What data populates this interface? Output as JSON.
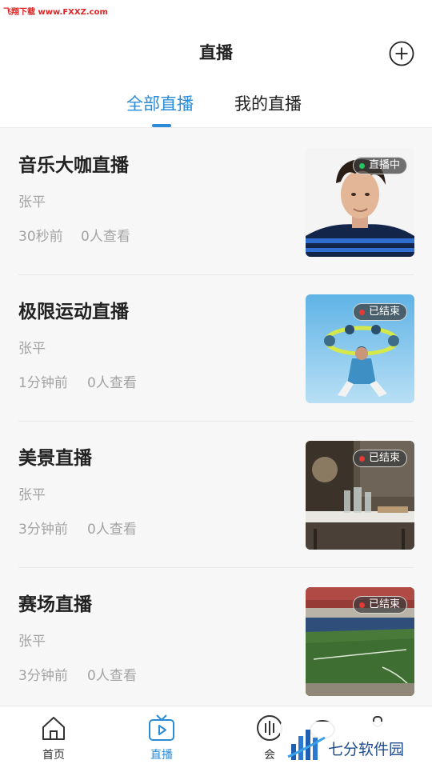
{
  "watermark_top": "飞翔下载 www.FXXZ.com",
  "header": {
    "title": "直播",
    "add_icon": "plus-circle-icon"
  },
  "tabs": [
    {
      "label": "全部直播",
      "active": true
    },
    {
      "label": "我的直播",
      "active": false
    }
  ],
  "colors": {
    "accent": "#2b8bd6",
    "live_dot": "#22c55e",
    "ended_dot": "#e53935"
  },
  "streams": [
    {
      "title": "音乐大咖直播",
      "author": "张平",
      "time": "30秒前",
      "views": "0人查看",
      "status": "直播中",
      "status_type": "live"
    },
    {
      "title": "极限运动直播",
      "author": "张平",
      "time": "1分钟前",
      "views": "0人查看",
      "status": "已结束",
      "status_type": "ended"
    },
    {
      "title": "美景直播",
      "author": "张平",
      "time": "3分钟前",
      "views": "0人查看",
      "status": "已结束",
      "status_type": "ended"
    },
    {
      "title": "赛场直播",
      "author": "张平",
      "time": "3分钟前",
      "views": "0人查看",
      "status": "已结束",
      "status_type": "ended"
    }
  ],
  "bottom_nav": [
    {
      "label": "首页",
      "icon": "home-icon"
    },
    {
      "label": "直播",
      "icon": "tv-play-icon",
      "active": true
    },
    {
      "label": "会",
      "icon": "meeting-icon"
    },
    {
      "label": "",
      "icon": "chat-icon"
    },
    {
      "label": "",
      "icon": "user-icon"
    }
  ],
  "brand_watermark": "七分软件园"
}
